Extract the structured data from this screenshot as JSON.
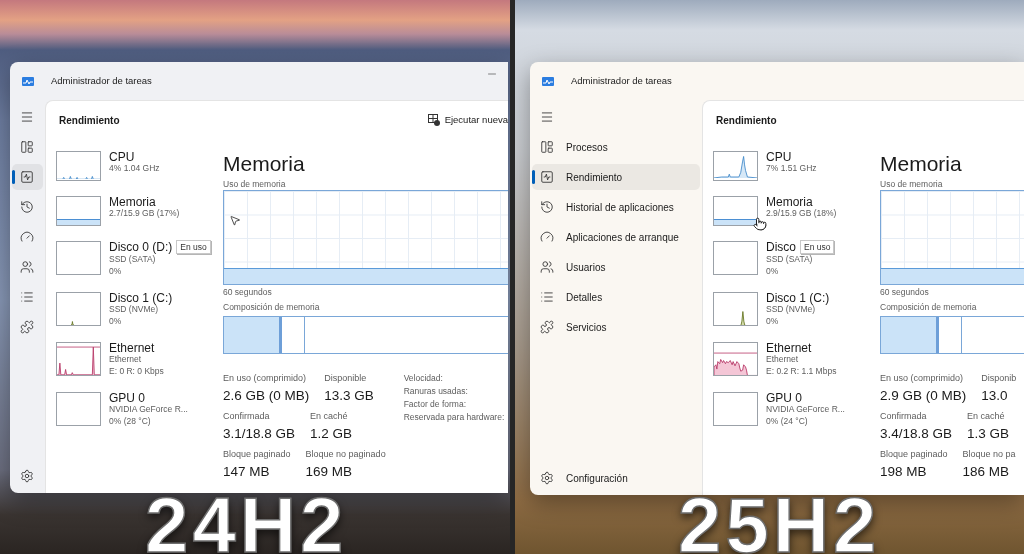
{
  "panes": [
    {
      "version_label": "24H2",
      "window": {
        "title": "Administrador de tareas",
        "title_bar_buttons": [
          {
            "kind": "minimize"
          }
        ],
        "cursor": {
          "kind": "arrow"
        },
        "sidebar": {
          "expanded": false,
          "items": [
            {
              "selected": false
            },
            {
              "selected": true
            },
            {
              "selected": false
            },
            {
              "selected": false
            },
            {
              "selected": false
            },
            {
              "selected": false
            },
            {
              "selected": false
            }
          ]
        },
        "page": {
          "title": "Rendimiento",
          "actions": [
            {
              "label": "Ejecutar nueva"
            }
          ]
        },
        "devices": [
          {
            "kind": "cpu",
            "name": "CPU",
            "details": [
              "4% 1.04 GHz"
            ]
          },
          {
            "kind": "memory",
            "name": "Memoria",
            "details": [
              "2.7/15.9 GB (17%)"
            ]
          },
          {
            "kind": "disk",
            "name": "Disco 0 (D:)",
            "tooltip": "En uso",
            "details": [
              "SSD (SATA)",
              "0%"
            ]
          },
          {
            "kind": "disk",
            "name": "Disco 1 (C:)",
            "details": [
              "SSD (NVMe)",
              "0%"
            ]
          },
          {
            "kind": "network",
            "name": "Ethernet",
            "details": [
              "Ethernet",
              "E: 0 R: 0 Kbps"
            ]
          },
          {
            "kind": "gpu",
            "name": "GPU 0",
            "details": [
              "NVIDIA GeForce R...",
              "0% (28 °C)"
            ]
          }
        ],
        "detail": {
          "title": "Memoria",
          "graph_label": "Uso de memoria",
          "graph_time": "60 segundos",
          "composition_label": "Composición de memoria",
          "stat_rows": [
            [
              {
                "label": "En uso (comprimido)",
                "value": "2.6 GB (0 MB)"
              },
              {
                "label": "Disponible",
                "value": "13.3 GB"
              }
            ],
            [
              {
                "label": "Confirmada",
                "value": "3.1/18.8 GB"
              },
              {
                "label": "En caché",
                "value": "1.2 GB"
              }
            ],
            [
              {
                "label": "Bloque paginado",
                "value": "147 MB"
              },
              {
                "label": "Bloque no paginado",
                "value": "169 MB"
              }
            ]
          ],
          "properties": [
            "Velocidad:",
            "Ranuras usadas:",
            "Factor de forma:",
            "Reservada para hardware:"
          ]
        }
      }
    },
    {
      "version_label": "25H2",
      "window": {
        "title": "Administrador de tareas",
        "cursor": {
          "kind": "hand"
        },
        "sidebar": {
          "expanded": true,
          "items": [
            {
              "label": "Procesos",
              "selected": false
            },
            {
              "label": "Rendimiento",
              "selected": true
            },
            {
              "label": "Historial de aplicaciones",
              "selected": false
            },
            {
              "label": "Aplicaciones de arranque",
              "selected": false
            },
            {
              "label": "Usuarios",
              "selected": false
            },
            {
              "label": "Detalles",
              "selected": false
            },
            {
              "label": "Servicios",
              "selected": false
            }
          ],
          "settings_label": "Configuración"
        },
        "page": {
          "title": "Rendimiento"
        },
        "devices": [
          {
            "kind": "cpu",
            "name": "CPU",
            "details": [
              "7% 1.51 GHz"
            ]
          },
          {
            "kind": "memory",
            "name": "Memoria",
            "details": [
              "2.9/15.9 GB (18%)"
            ]
          },
          {
            "kind": "disk",
            "name": "Disco",
            "tooltip": "En uso",
            "details": [
              "SSD (SATA)",
              "0%"
            ]
          },
          {
            "kind": "disk",
            "name": "Disco 1 (C:)",
            "details": [
              "SSD (NVMe)",
              "0%"
            ]
          },
          {
            "kind": "network",
            "name": "Ethernet",
            "details": [
              "Ethernet",
              "E: 0.2 R: 1.1 Mbps"
            ]
          },
          {
            "kind": "gpu",
            "name": "GPU 0",
            "details": [
              "NVIDIA GeForce R...",
              "0% (24 °C)"
            ]
          }
        ],
        "detail": {
          "title": "Memoria",
          "graph_label": "Uso de memoria",
          "graph_time": "60 segundos",
          "composition_label": "Composición de memoria",
          "stat_rows": [
            [
              {
                "label": "En uso (comprimido)",
                "value": "2.9 GB (0 MB)"
              },
              {
                "label": "Disponib",
                "value": "13.0"
              }
            ],
            [
              {
                "label": "Confirmada",
                "value": "3.4/18.8 GB"
              },
              {
                "label": "En caché",
                "value": "1.3 GB"
              }
            ],
            [
              {
                "label": "Bloque paginado",
                "value": "198 MB"
              },
              {
                "label": "Bloque no pa",
                "value": "186 MB"
              }
            ]
          ]
        }
      }
    }
  ]
}
